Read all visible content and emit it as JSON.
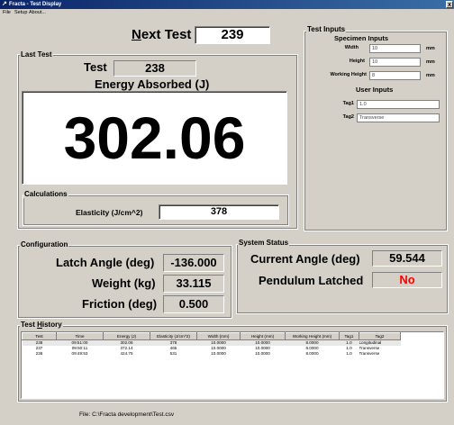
{
  "window": {
    "title": "Fracta - Test Display",
    "close_glyph": "x"
  },
  "menu": {
    "file": "File",
    "setup": "Setup",
    "about": "About..."
  },
  "next_test": {
    "label_prefix": "",
    "label_underlined": "N",
    "label_rest": "ext Test",
    "value": "239"
  },
  "last_test": {
    "group_label": "Last Test",
    "test_label": "Test",
    "test_value": "238",
    "energy_label": "Energy Absorbed (J)",
    "energy_value": "302.06"
  },
  "calculations": {
    "group_label": "Calculations",
    "elasticity_label": "Elasticity (J/cm^2)",
    "elasticity_value": "378"
  },
  "test_inputs": {
    "group_label": "Test Inputs",
    "specimen_heading": "Specimen Inputs",
    "width_label": "Width",
    "width_value": "10",
    "width_unit": "mm",
    "height_label": "Height",
    "height_value": "10",
    "height_unit": "mm",
    "wheight_label": "Working Height",
    "wheight_value": "8",
    "wheight_unit": "mm",
    "user_heading": "User Inputs",
    "tag1_label": "Tag1",
    "tag1_value": "1.0",
    "tag2_label": "Tag2",
    "tag2_value": "Transverse"
  },
  "configuration": {
    "group_label": "Configuration",
    "latch_label": "Latch Angle (deg)",
    "latch_value": "-136.000",
    "weight_label": "Weight (kg)",
    "weight_value": "33.115",
    "friction_label": "Friction (deg)",
    "friction_value": "0.500"
  },
  "system_status": {
    "group_label": "System Status",
    "current_label": "Current Angle (deg)",
    "current_value": "59.544",
    "latched_label": "Pendulum Latched",
    "latched_value": "No",
    "latched_color": "#ff0000"
  },
  "history": {
    "group_label_prefix": "Test ",
    "group_label_underlined": "H",
    "group_label_rest": "istory",
    "columns": [
      "Test",
      "Time",
      "Energy (J)",
      "Elasticity (J/cm^2)",
      "Width (mm)",
      "Height (mm)",
      "Working Height (mm)",
      "Tag1",
      "Tag2"
    ],
    "rows": [
      [
        "238",
        "09:51:00",
        "302.06",
        "378",
        "10.0000",
        "10.0000",
        "8.0000",
        "1.0",
        "Longitudinal"
      ],
      [
        "237",
        "09:50:11",
        "372.14",
        "465",
        "10.0000",
        "10.0000",
        "8.0000",
        "1.0",
        "Transverse"
      ],
      [
        "236",
        "09:49:53",
        "424.75",
        "531",
        "10.0000",
        "10.0000",
        "8.0000",
        "1.0",
        "Transverse"
      ]
    ]
  },
  "status_bar": {
    "file_text": "File:  C:\\Fracta development\\Test.csv"
  }
}
